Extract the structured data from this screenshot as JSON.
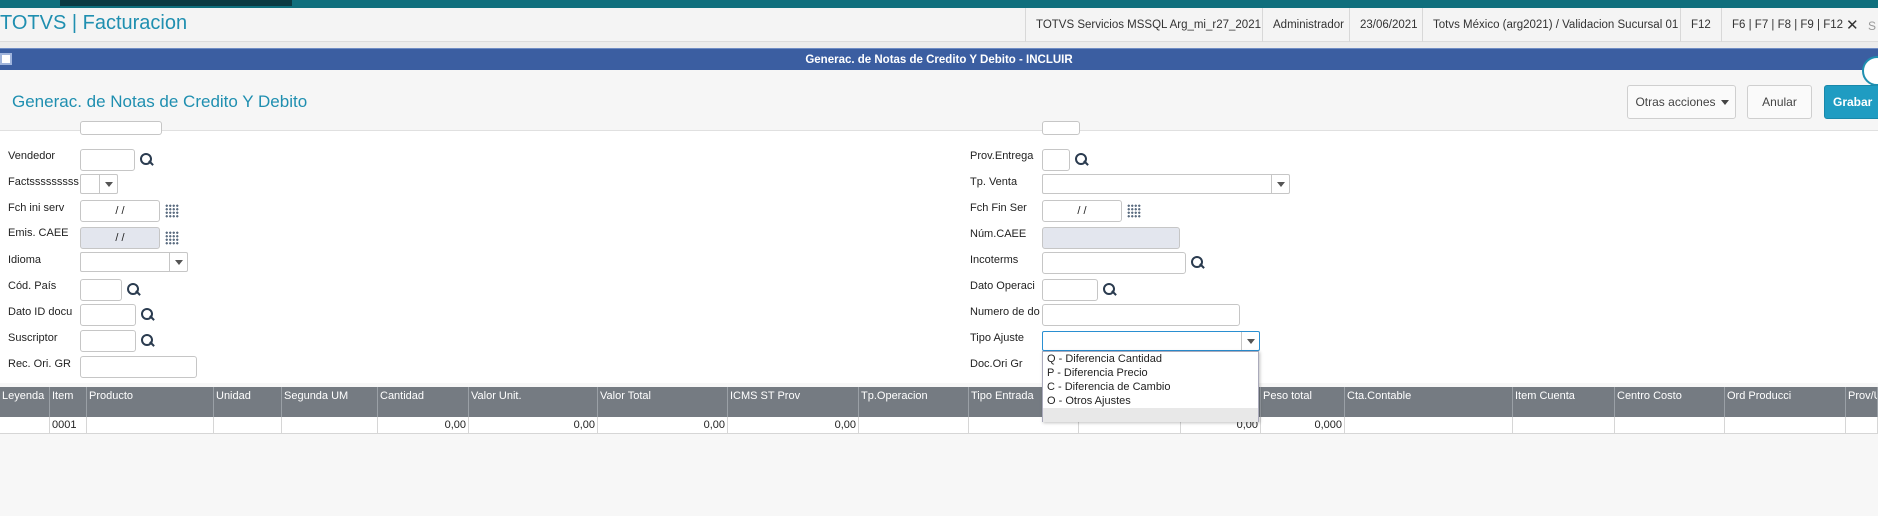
{
  "app": {
    "title": "TOTVS | Facturacion"
  },
  "header": {
    "environment": "TOTVS Servicios MSSQL Arg_mi_r27_2021",
    "user": "Administrador",
    "date": "23/06/2021",
    "branch": "Totvs México (arg2021) / Validacion Sucursal 01",
    "f12": "F12",
    "shortcuts": "F6 | F7 | F8 | F9 | F12",
    "close": "✕",
    "close2": "S"
  },
  "window": {
    "title": "Generac. de Notas de Credito Y Debito - INCLUIR"
  },
  "form": {
    "title": "Generac. de Notas de Credito Y Debito",
    "otras_acciones": "Otras acciones",
    "anular": "Anular",
    "grabar": "Grabar"
  },
  "left_fields": {
    "vendedor": "Vendedor",
    "facts": "Factsssssssss",
    "fch_ini": "Fch ini serv",
    "fch_ini_value": "/ /",
    "emis_caee": "Emis. CAEE",
    "emis_caee_value": "/ /",
    "idioma": "Idioma",
    "cod_pais": "Cód. País",
    "dato_id": "Dato ID docu",
    "suscriptor": "Suscriptor",
    "rec_ori": "Rec. Ori. GR"
  },
  "right_fields": {
    "prov_entrega": "Prov.Entrega",
    "tp_venta": "Tp. Venta",
    "fch_fin": "Fch Fin Ser",
    "fch_fin_value": "/ /",
    "num_caee": "Núm.CAEE",
    "incoterms": "Incoterms",
    "dato_operaci": "Dato Operaci",
    "numero_do": "Numero de do",
    "tipo_ajuste": "Tipo Ajuste",
    "doc_ori": "Doc.Ori Gr"
  },
  "tipo_ajuste_options": [
    "Q - Diferencia Cantidad",
    "P - Diferencia Precio",
    "C - Diferencia de Cambio",
    "O - Otros Ajustes"
  ],
  "grid": {
    "headers": [
      "Leyenda",
      "Item",
      "Producto",
      "Unidad",
      "Segunda UM",
      "Cantidad",
      "Valor Unit.",
      "Valor Total",
      "ICMS ST Prov",
      "Tp.Operacion",
      "Tipo Entrada",
      "",
      "",
      "Peso total",
      "Cta.Contable",
      "Item Cuenta",
      "Centro Costo",
      "Ord Producci",
      "Prov/U"
    ],
    "row": {
      "item": "0001",
      "cantidad": "0,00",
      "valor_unit": "0,00",
      "valor_total": "0,00",
      "icms": "0,00",
      "col12": "0,00",
      "peso_total": "0,000"
    }
  }
}
